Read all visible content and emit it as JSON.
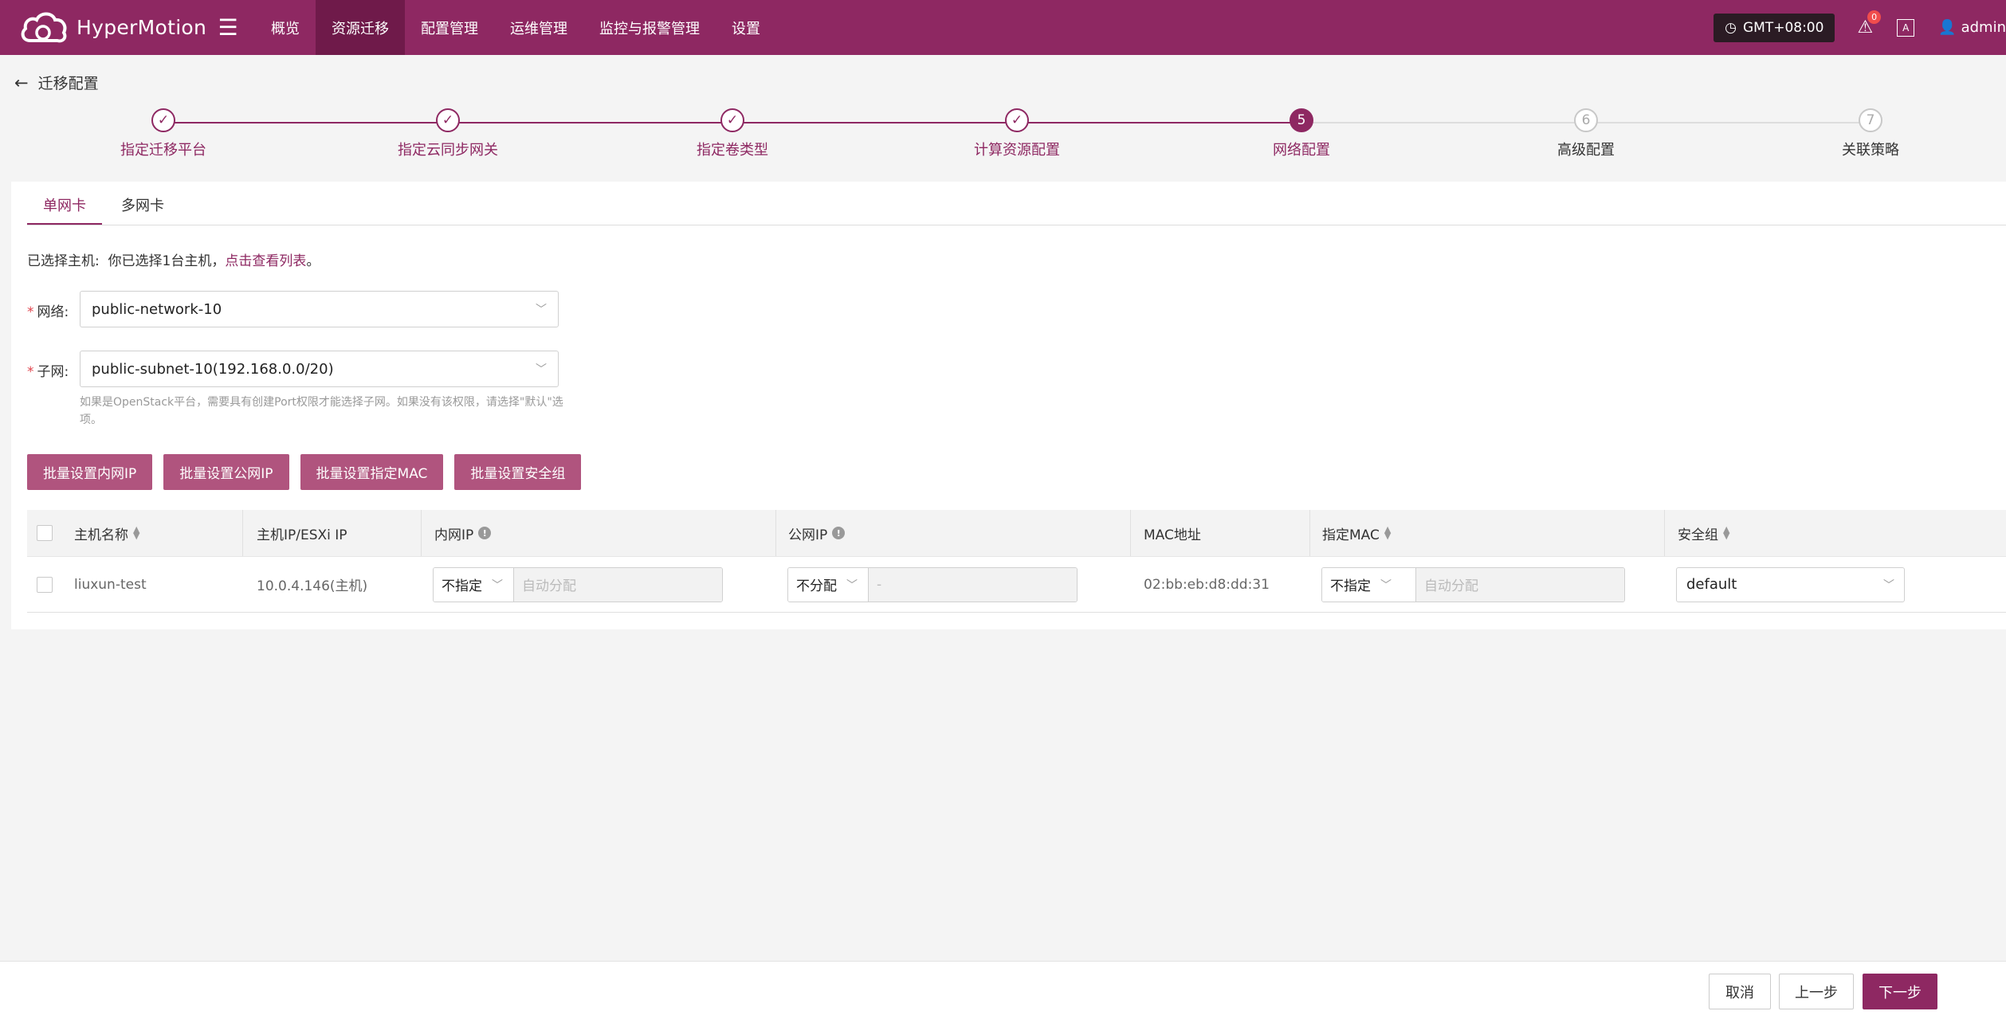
{
  "app": {
    "name": "HyperMotion"
  },
  "nav": {
    "items": [
      {
        "label": "概览",
        "active": false
      },
      {
        "label": "资源迁移",
        "active": true
      },
      {
        "label": "配置管理",
        "active": false
      },
      {
        "label": "运维管理",
        "active": false
      },
      {
        "label": "监控与报警管理",
        "active": false
      },
      {
        "label": "设置",
        "active": false
      }
    ]
  },
  "header": {
    "timezone": "GMT+08:00",
    "notifications": "0",
    "lang_icon": "A",
    "user": "admin"
  },
  "page": {
    "title": "迁移配置"
  },
  "steps": [
    {
      "index": "1",
      "label": "指定迁移平台",
      "state": "done"
    },
    {
      "index": "2",
      "label": "指定云同步网关",
      "state": "done"
    },
    {
      "index": "3",
      "label": "指定卷类型",
      "state": "done"
    },
    {
      "index": "4",
      "label": "计算资源配置",
      "state": "done"
    },
    {
      "index": "5",
      "label": "网络配置",
      "state": "active"
    },
    {
      "index": "6",
      "label": "高级配置",
      "state": "todo"
    },
    {
      "index": "7",
      "label": "关联策略",
      "state": "todo"
    }
  ],
  "tabs": [
    {
      "label": "单网卡",
      "active": true
    },
    {
      "label": "多网卡",
      "active": false
    }
  ],
  "selected": {
    "prefix": "已选择主机:",
    "text": "你已选择1台主机，",
    "link": "点击查看列表",
    "suffix": "。"
  },
  "form": {
    "network": {
      "label": "网络:",
      "value": "public-network-10"
    },
    "subnet": {
      "label": "子网:",
      "value": "public-subnet-10(192.168.0.0/20)"
    },
    "hint": "如果是OpenStack平台，需要具有创建Port权限才能选择子网。如果没有该权限，请选择\"默认\"选项。"
  },
  "batch_buttons": [
    "批量设置内网IP",
    "批量设置公网IP",
    "批量设置指定MAC",
    "批量设置安全组"
  ],
  "table": {
    "columns": [
      "主机名称",
      "主机IP/ESXi IP",
      "内网IP",
      "公网IP",
      "MAC地址",
      "指定MAC",
      "安全组"
    ],
    "rows": [
      {
        "hostname": "liuxun-test",
        "host_ip": "10.0.4.146(主机)",
        "private_ip_mode": "不指定",
        "private_ip_placeholder": "自动分配",
        "public_ip_mode": "不分配",
        "public_ip_placeholder": "-",
        "mac": "02:bb:eb:d8:dd:31",
        "mac_mode": "不指定",
        "mac_placeholder": "自动分配",
        "security_group": "default"
      }
    ]
  },
  "footer": {
    "cancel": "取消",
    "prev": "上一步",
    "next": "下一步"
  }
}
